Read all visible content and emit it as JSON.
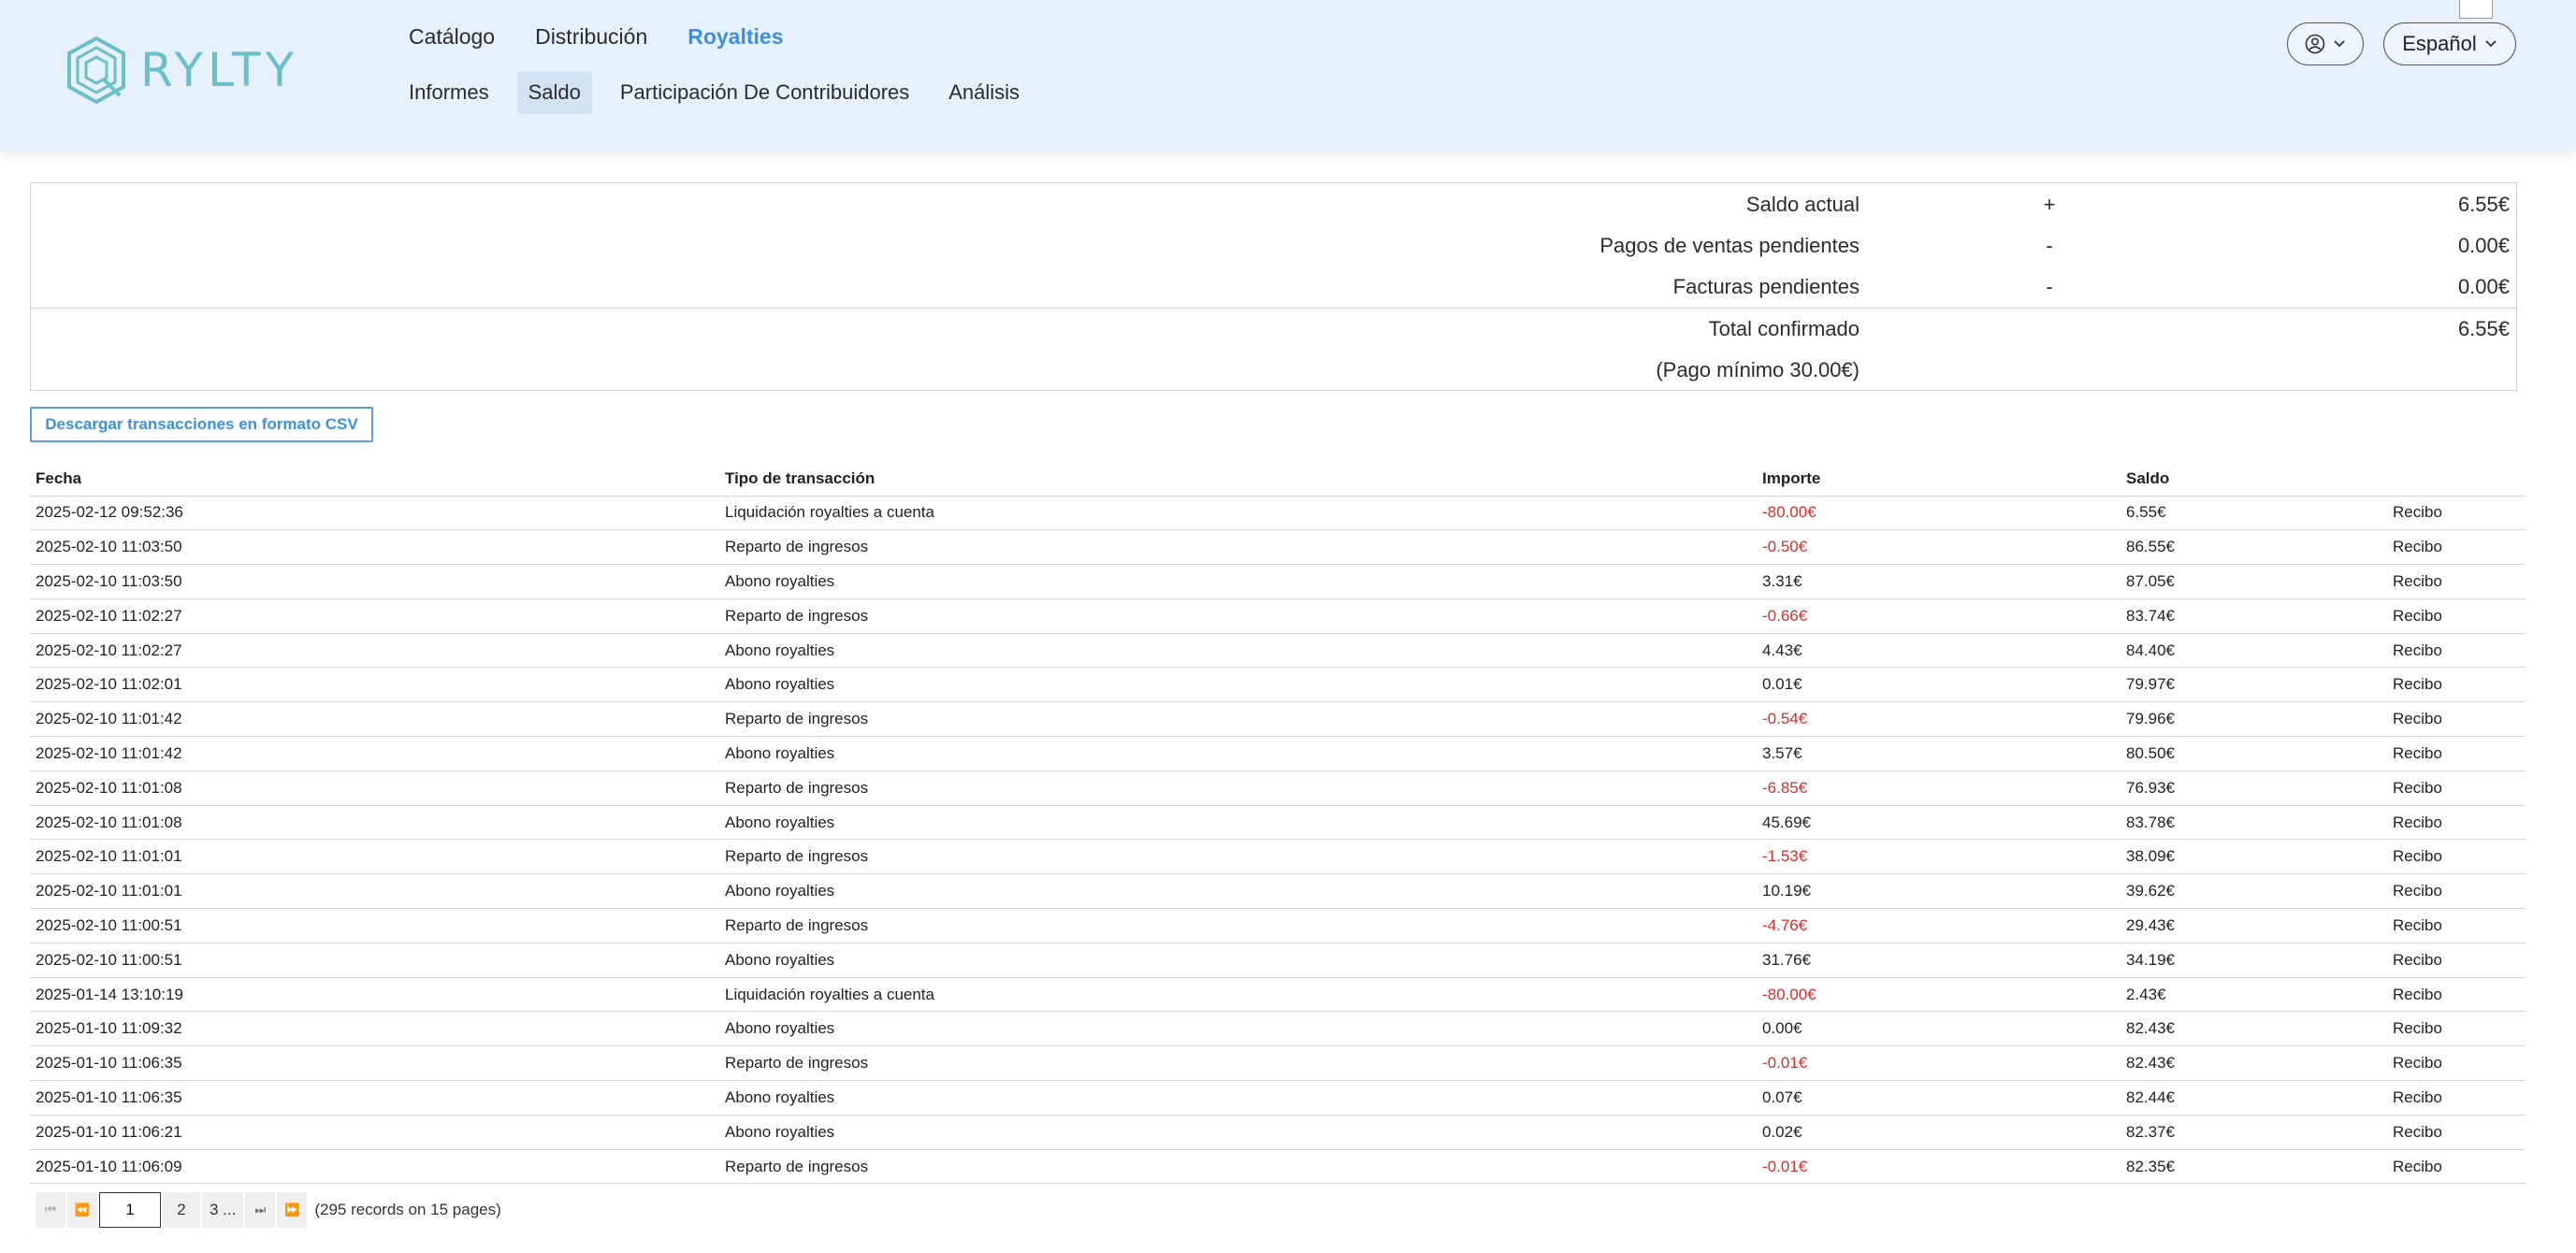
{
  "brand": {
    "name": "RYLTY"
  },
  "nav": {
    "top": [
      "Catálogo",
      "Distribución",
      "Royalties"
    ],
    "active_top": "Royalties",
    "sub": [
      "Informes",
      "Saldo",
      "Participación De Contribuidores",
      "Análisis"
    ],
    "active_sub": "Saldo"
  },
  "header": {
    "language": "Español"
  },
  "summary": {
    "current_label": "Saldo actual",
    "current_sign": "+",
    "current_value": "6.55€",
    "pending_sales_label": "Pagos de ventas pendientes",
    "pending_sales_sign": "-",
    "pending_sales_value": "0.00€",
    "pending_invoices_label": "Facturas pendientes",
    "pending_invoices_sign": "-",
    "pending_invoices_value": "0.00€",
    "total_label": "Total confirmado",
    "total_value": "6.55€",
    "minimum_note": "(Pago mínimo 30.00€)"
  },
  "csv_button": "Descargar transacciones en formato CSV",
  "table": {
    "headers": [
      "Fecha",
      "Tipo de transacción",
      "Importe",
      "Saldo",
      ""
    ],
    "rows": [
      {
        "fecha": "2025-02-12 09:52:36",
        "tipo": "Liquidación royalties a cuenta",
        "importe": "-80.00€",
        "saldo": "6.55€",
        "recibo": "Recibo"
      },
      {
        "fecha": "2025-02-10 11:03:50",
        "tipo": "Reparto de ingresos",
        "importe": "-0.50€",
        "saldo": "86.55€",
        "recibo": "Recibo"
      },
      {
        "fecha": "2025-02-10 11:03:50",
        "tipo": "Abono royalties",
        "importe": "3.31€",
        "saldo": "87.05€",
        "recibo": "Recibo"
      },
      {
        "fecha": "2025-02-10 11:02:27",
        "tipo": "Reparto de ingresos",
        "importe": "-0.66€",
        "saldo": "83.74€",
        "recibo": "Recibo"
      },
      {
        "fecha": "2025-02-10 11:02:27",
        "tipo": "Abono royalties",
        "importe": "4.43€",
        "saldo": "84.40€",
        "recibo": "Recibo"
      },
      {
        "fecha": "2025-02-10 11:02:01",
        "tipo": "Abono royalties",
        "importe": "0.01€",
        "saldo": "79.97€",
        "recibo": "Recibo"
      },
      {
        "fecha": "2025-02-10 11:01:42",
        "tipo": "Reparto de ingresos",
        "importe": "-0.54€",
        "saldo": "79.96€",
        "recibo": "Recibo"
      },
      {
        "fecha": "2025-02-10 11:01:42",
        "tipo": "Abono royalties",
        "importe": "3.57€",
        "saldo": "80.50€",
        "recibo": "Recibo"
      },
      {
        "fecha": "2025-02-10 11:01:08",
        "tipo": "Reparto de ingresos",
        "importe": "-6.85€",
        "saldo": "76.93€",
        "recibo": "Recibo"
      },
      {
        "fecha": "2025-02-10 11:01:08",
        "tipo": "Abono royalties",
        "importe": "45.69€",
        "saldo": "83.78€",
        "recibo": "Recibo"
      },
      {
        "fecha": "2025-02-10 11:01:01",
        "tipo": "Reparto de ingresos",
        "importe": "-1.53€",
        "saldo": "38.09€",
        "recibo": "Recibo"
      },
      {
        "fecha": "2025-02-10 11:01:01",
        "tipo": "Abono royalties",
        "importe": "10.19€",
        "saldo": "39.62€",
        "recibo": "Recibo"
      },
      {
        "fecha": "2025-02-10 11:00:51",
        "tipo": "Reparto de ingresos",
        "importe": "-4.76€",
        "saldo": "29.43€",
        "recibo": "Recibo"
      },
      {
        "fecha": "2025-02-10 11:00:51",
        "tipo": "Abono royalties",
        "importe": "31.76€",
        "saldo": "34.19€",
        "recibo": "Recibo"
      },
      {
        "fecha": "2025-01-14 13:10:19",
        "tipo": "Liquidación royalties a cuenta",
        "importe": "-80.00€",
        "saldo": "2.43€",
        "recibo": "Recibo"
      },
      {
        "fecha": "2025-01-10 11:09:32",
        "tipo": "Abono royalties",
        "importe": "0.00€",
        "saldo": "82.43€",
        "recibo": "Recibo"
      },
      {
        "fecha": "2025-01-10 11:06:35",
        "tipo": "Reparto de ingresos",
        "importe": "-0.01€",
        "saldo": "82.43€",
        "recibo": "Recibo"
      },
      {
        "fecha": "2025-01-10 11:06:35",
        "tipo": "Abono royalties",
        "importe": "0.07€",
        "saldo": "82.44€",
        "recibo": "Recibo"
      },
      {
        "fecha": "2025-01-10 11:06:21",
        "tipo": "Abono royalties",
        "importe": "0.02€",
        "saldo": "82.37€",
        "recibo": "Recibo"
      },
      {
        "fecha": "2025-01-10 11:06:09",
        "tipo": "Reparto de ingresos",
        "importe": "-0.01€",
        "saldo": "82.35€",
        "recibo": "Recibo"
      }
    ]
  },
  "pagination": {
    "current": "1",
    "pages": [
      "2",
      "3 ..."
    ],
    "info": "(295 records on 15 pages)"
  },
  "colors": {
    "accent": "#3d8fe3",
    "negative": "#e02a2a",
    "header_bg": "#e7f1fb"
  },
  "icons": {
    "logo": "rylty-hexagon-logo",
    "user": "user-circle-icon",
    "chevron": "chevron-down-icon",
    "first": "first-page-icon",
    "prev": "prev-page-icon",
    "next": "next-page-icon",
    "last": "last-page-icon"
  }
}
